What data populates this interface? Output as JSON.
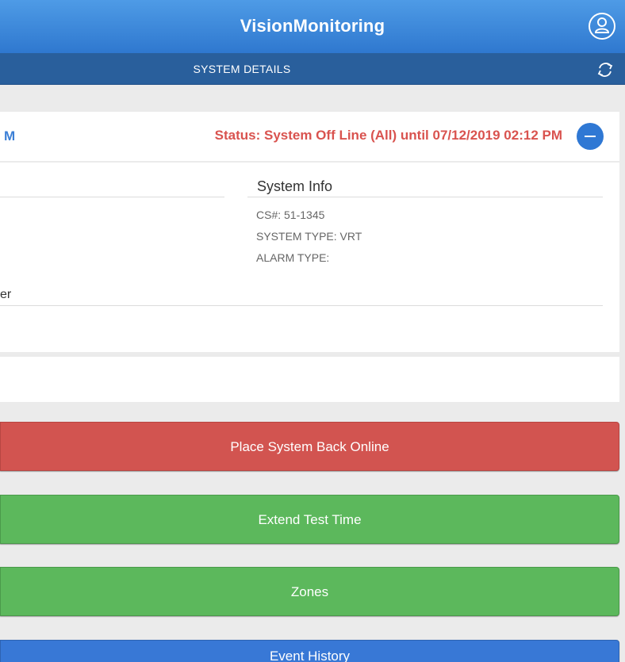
{
  "header": {
    "app_title": "VisionMonitoring",
    "user_icon": "user-avatar-icon"
  },
  "subheader": {
    "title": "SYSTEM DETAILS",
    "refresh_icon": "refresh-icon"
  },
  "status": {
    "left_label_fragment": "M",
    "text": "Status: System Off Line (All) until 07/12/2019 02:12 PM",
    "collapse_icon": "minus-circle-icon"
  },
  "system_info": {
    "title": "System Info",
    "cs_number": "CS#: 51-1345",
    "system_type": "SYSTEM TYPE: VRT",
    "alarm_type": "ALARM TYPE:",
    "left_fragment": "er"
  },
  "actions": {
    "place_back_online": "Place System Back Online",
    "extend_test_time": "Extend Test Time",
    "zones": "Zones",
    "event_history": "Event History"
  },
  "colors": {
    "header_blue": "#3a86dc",
    "subheader_blue": "#295f9c",
    "status_red": "#d9534f",
    "danger_button": "#d25450",
    "success_button": "#5cb85c",
    "primary_button": "#3878d6"
  }
}
